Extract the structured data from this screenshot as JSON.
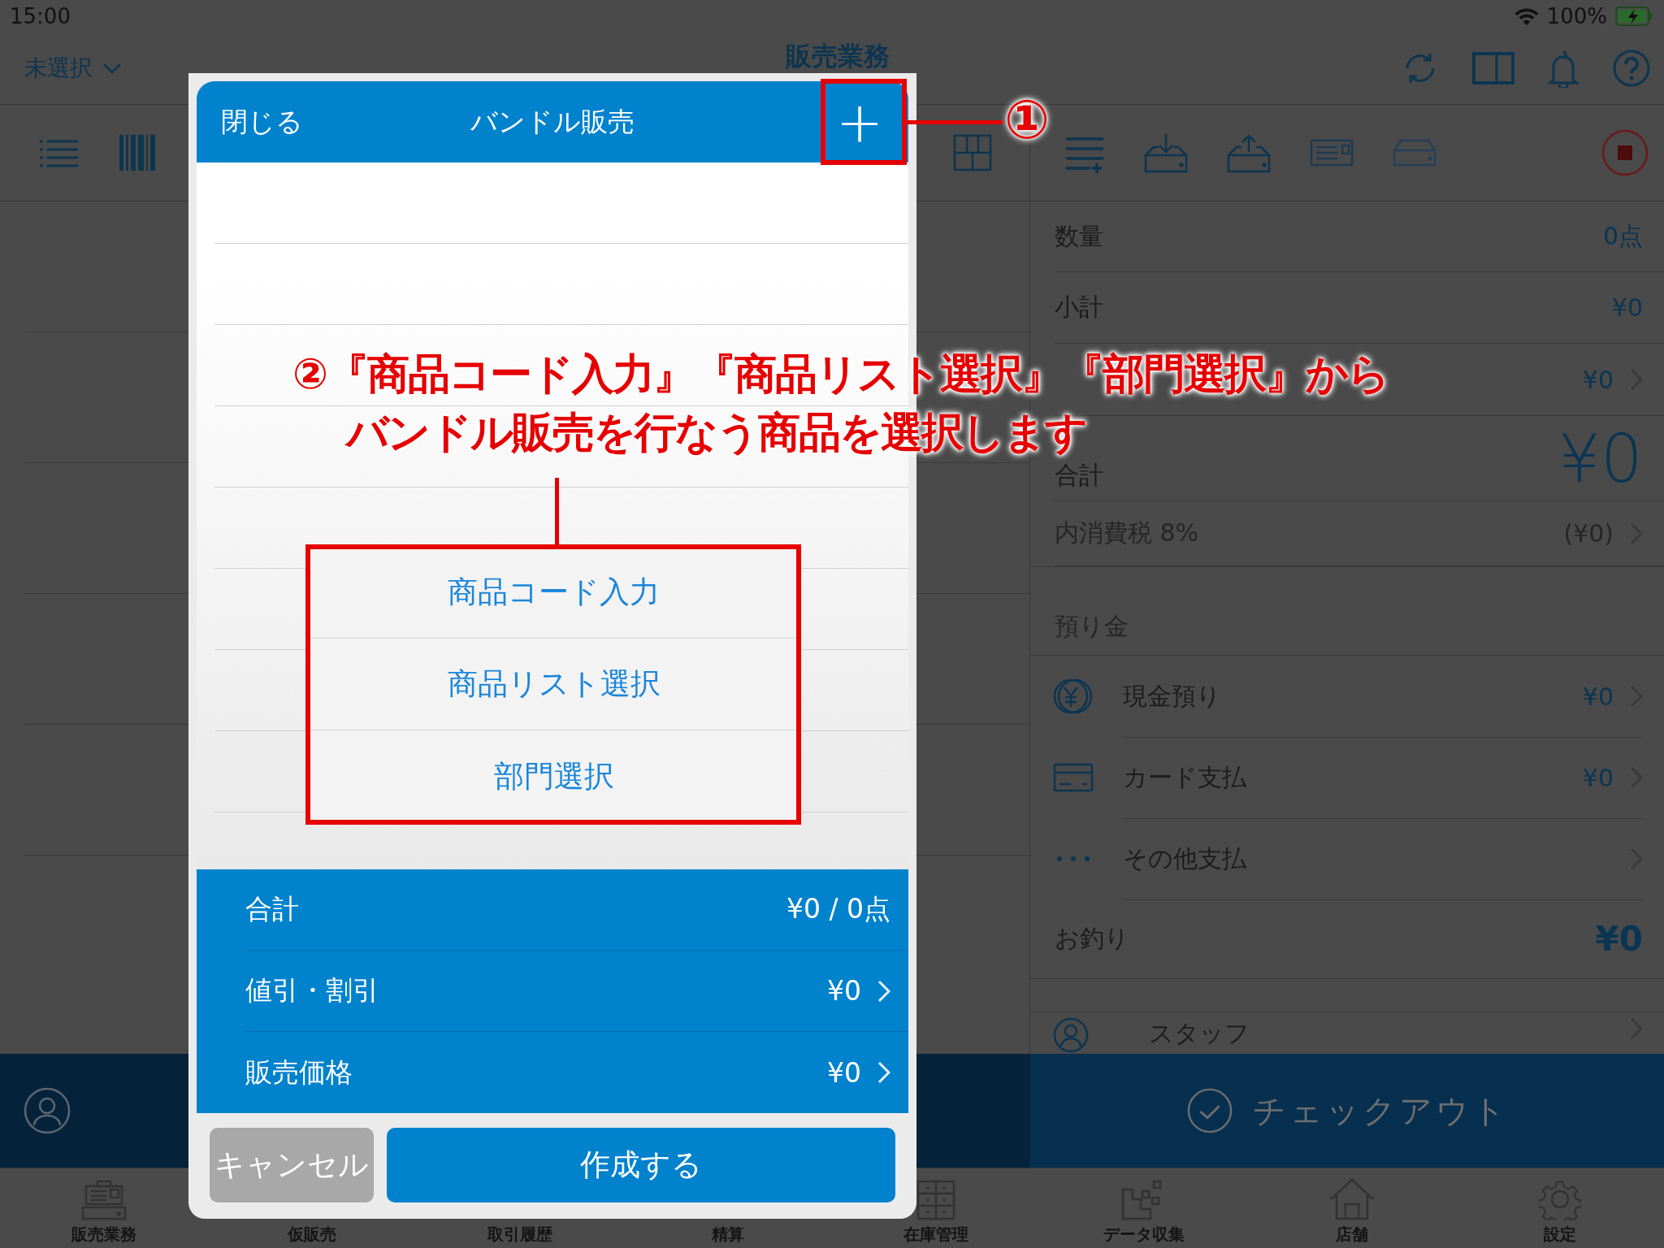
{
  "status_bar": {
    "time": "15:00",
    "battery": "100%"
  },
  "nav_bar": {
    "store_picker": "未選択",
    "title": "販売業務"
  },
  "summary": [
    {
      "kind": "plain",
      "label": "数量",
      "value": "0点"
    },
    {
      "kind": "plain",
      "label": "小計",
      "value": "¥0"
    },
    {
      "kind": "link",
      "value": "¥0"
    },
    {
      "kind": "total",
      "label": "合計",
      "value": "¥0"
    },
    {
      "kind": "tax",
      "label": "内消費税 8%",
      "value": "(¥0)"
    }
  ],
  "deposit": {
    "header": "預り金",
    "payments": [
      {
        "kind": "cash",
        "label": "現金預り",
        "value": "¥0"
      },
      {
        "kind": "card",
        "label": "カード支払",
        "value": "¥0"
      },
      {
        "kind": "other",
        "label": "その他支払"
      }
    ]
  },
  "change": {
    "label": "お釣り",
    "value": "¥0"
  },
  "staff": {
    "label": "スタッフ"
  },
  "checkout": {
    "label": "チェックアウト"
  },
  "tabs": [
    {
      "label": "販売業務"
    },
    {
      "label": "仮販売"
    },
    {
      "label": "取引履歴"
    },
    {
      "label": "精算"
    },
    {
      "label": "在庫管理"
    },
    {
      "label": "データ収集"
    },
    {
      "label": "店舗"
    },
    {
      "label": "設定"
    }
  ],
  "modal": {
    "close": "閉じる",
    "title": "バンドル販売",
    "add": "+",
    "menu": [
      "商品コード入力",
      "商品リスト選択",
      "部門選択"
    ],
    "totals": [
      {
        "kind": "plain",
        "label": "合計",
        "value": "¥0 / 0点"
      },
      {
        "kind": "link",
        "label": "値引・割引",
        "value": "¥0"
      },
      {
        "kind": "link",
        "label": "販売価格",
        "value": "¥0"
      }
    ],
    "cancel": "キャンセル",
    "create": "作成する"
  },
  "annotations": {
    "step_1": "①",
    "step_2": [
      "②『商品コード入力』『商品リスト選択』『部門選択』から",
      "バンドル販売を行なう商品を選択します"
    ]
  }
}
